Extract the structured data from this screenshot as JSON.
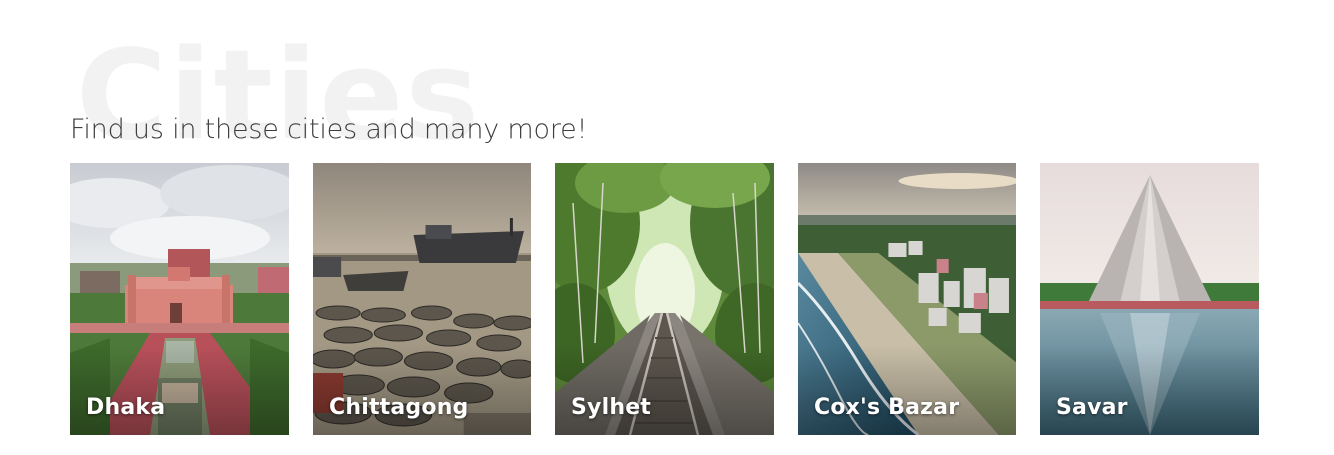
{
  "section": {
    "background_word": "Cities",
    "subtitle": "Find us in these cities and many more!"
  },
  "cities": [
    {
      "name": "Dhaka"
    },
    {
      "name": "Chittagong"
    },
    {
      "name": "Sylhet"
    },
    {
      "name": "Cox's Bazar"
    },
    {
      "name": "Savar"
    }
  ]
}
